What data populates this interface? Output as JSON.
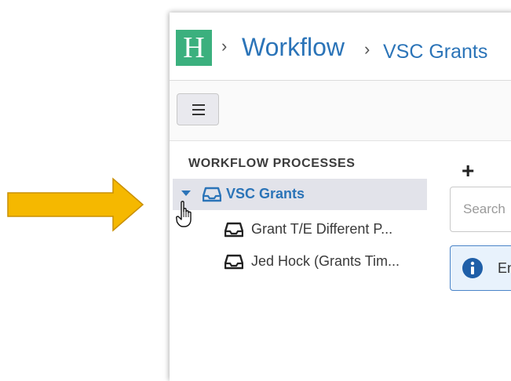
{
  "header": {
    "logo_letter": "H",
    "breadcrumb": [
      {
        "label": "Workflow"
      },
      {
        "label": "VSC Grants"
      }
    ],
    "separator": "›"
  },
  "toolbar": {
    "menu_icon": "hamburger-icon"
  },
  "sidebar": {
    "title": "WORKFLOW PROCESSES",
    "items": [
      {
        "label": "VSC Grants",
        "icon": "inbox-icon",
        "expanded": true,
        "selected": true
      },
      {
        "label": "Grant T/E Different P...",
        "icon": "inbox-icon"
      },
      {
        "label": "Jed Hock (Grants Tim...",
        "icon": "inbox-icon"
      }
    ]
  },
  "main": {
    "add_label": "+",
    "search_placeholder": "Search",
    "info_text": "En"
  },
  "colors": {
    "accent": "#2b74b8",
    "logo_bg": "#3bb07e",
    "arrow": "#f5b800",
    "selected_row": "#e2e3ea"
  }
}
